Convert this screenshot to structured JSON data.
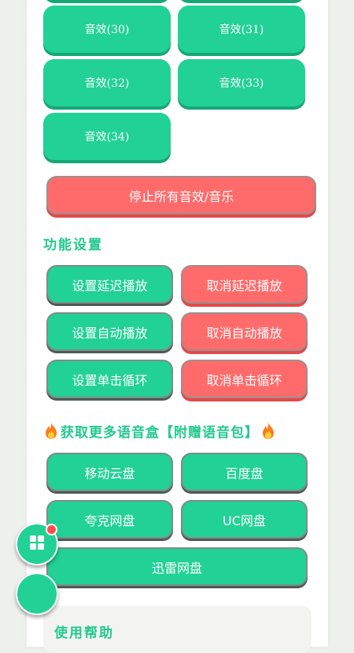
{
  "sound_effects": [
    {
      "label": "音效(30)"
    },
    {
      "label": "音效(31)"
    },
    {
      "label": "音效(32)"
    },
    {
      "label": "音效(33)"
    },
    {
      "label": "音效(34)"
    }
  ],
  "stop_all_label": "停止所有音效/音乐",
  "settings": {
    "title": "功能设置",
    "set_delay": "设置延迟播放",
    "cancel_delay": "取消延迟播放",
    "set_auto": "设置自动播放",
    "cancel_auto": "取消自动播放",
    "set_loop": "设置单击循环",
    "cancel_loop": "取消单击循环"
  },
  "more": {
    "title": "获取更多语音盒【附赠语音包】",
    "links": [
      "移动云盘",
      "百度盘",
      "夸克网盘",
      "UC网盘",
      "迅雷网盘"
    ]
  },
  "help": {
    "title": "使用帮助"
  },
  "colors": {
    "primary_green": "#22d195",
    "danger_red": "#ff6b6b",
    "title_green": "#22c98e",
    "badge_red": "#ff4d4f"
  },
  "icons": {
    "flame": "flame-icon",
    "grid": "grid-icon"
  }
}
